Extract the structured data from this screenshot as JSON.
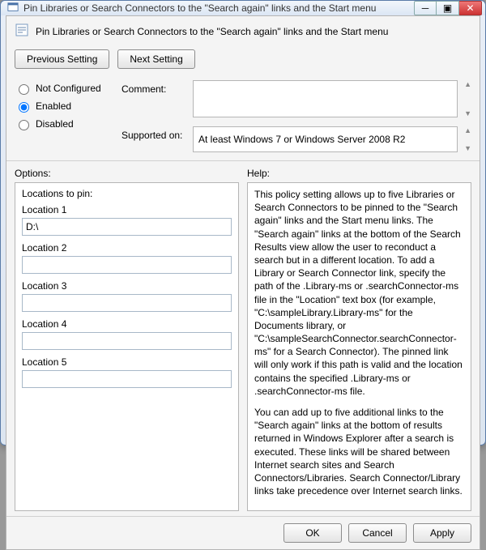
{
  "window": {
    "title": "Pin Libraries or Search Connectors to the \"Search again\" links and the Start menu"
  },
  "header": {
    "title": "Pin Libraries or Search Connectors to the \"Search again\" links and the Start menu"
  },
  "nav": {
    "prev": "Previous Setting",
    "next": "Next Setting"
  },
  "state": {
    "not_configured": "Not Configured",
    "enabled": "Enabled",
    "disabled": "Disabled",
    "selected": "enabled"
  },
  "meta": {
    "comment_label": "Comment:",
    "comment_value": "",
    "supported_label": "Supported on:",
    "supported_value": "At least Windows 7 or Windows Server 2008 R2"
  },
  "options": {
    "heading": "Options:",
    "group_label": "Locations to pin:",
    "locations": [
      {
        "label": "Location 1",
        "value": "D:\\"
      },
      {
        "label": "Location 2",
        "value": ""
      },
      {
        "label": "Location 3",
        "value": ""
      },
      {
        "label": "Location 4",
        "value": ""
      },
      {
        "label": "Location 5",
        "value": ""
      }
    ]
  },
  "help": {
    "heading": "Help:",
    "para1": "This policy setting allows up to five Libraries or Search Connectors to be pinned to the \"Search again\" links and the Start menu links. The \"Search again\" links at the bottom of the Search Results view allow the user to reconduct a search but in a different location.  To add a Library or Search Connector link, specify the path of the .Library-ms or .searchConnector-ms file in the \"Location\" text box (for example, \"C:\\sampleLibrary.Library-ms\" for the Documents library, or \"C:\\sampleSearchConnector.searchConnector-ms\" for a Search Connector). The pinned link will only work if this path is valid and the location contains the specified .Library-ms or .searchConnector-ms file.",
    "para2": "You can add up to five additional links to the \"Search again\" links at the bottom of results returned in Windows Explorer after a search is executed.  These links will be shared between Internet search sites and Search Connectors/Libraries.  Search Connector/Library links take precedence over Internet search links."
  },
  "footer": {
    "ok": "OK",
    "cancel": "Cancel",
    "apply": "Apply"
  }
}
